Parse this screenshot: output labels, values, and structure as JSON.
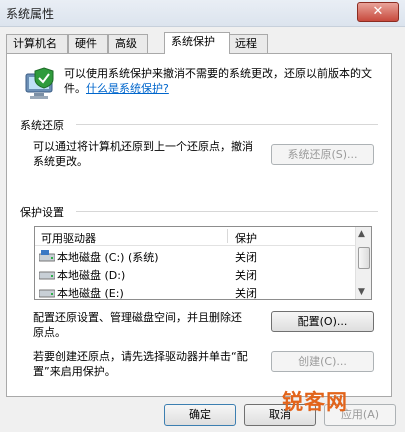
{
  "window": {
    "title": "系统属性",
    "close_glyph": "✕"
  },
  "tabs": [
    "计算机名",
    "硬件",
    "高级",
    "系统保护",
    "远程"
  ],
  "intro": {
    "text": "可以使用系统保护来撤消不需要的系统更改，还原以前版本的文件。",
    "link": "什么是系统保护?"
  },
  "restore": {
    "title": "系统还原",
    "desc": "可以通过将计算机还原到上一个还原点，撤消系统更改。",
    "button": "系统还原(S)..."
  },
  "protection": {
    "title": "保护设置",
    "columns": [
      "可用驱动器",
      "保护"
    ],
    "drives": [
      {
        "name": "本地磁盘  (C:)  (系统)",
        "status": "关闭"
      },
      {
        "name": "本地磁盘  (D:)",
        "status": "关闭"
      },
      {
        "name": "本地磁盘  (E:)",
        "status": "关闭"
      }
    ]
  },
  "configure": {
    "desc": "配置还原设置、管理磁盘空间，并且删除还原点。",
    "button": "配置(O)..."
  },
  "create": {
    "desc": "若要创建还原点，请先选择驱动器并单击“配置”来启用保护。",
    "button": "创建(C)..."
  },
  "footer": {
    "ok": "确定",
    "cancel": "取消",
    "apply": "应用(A)"
  },
  "watermark": "锐客网"
}
